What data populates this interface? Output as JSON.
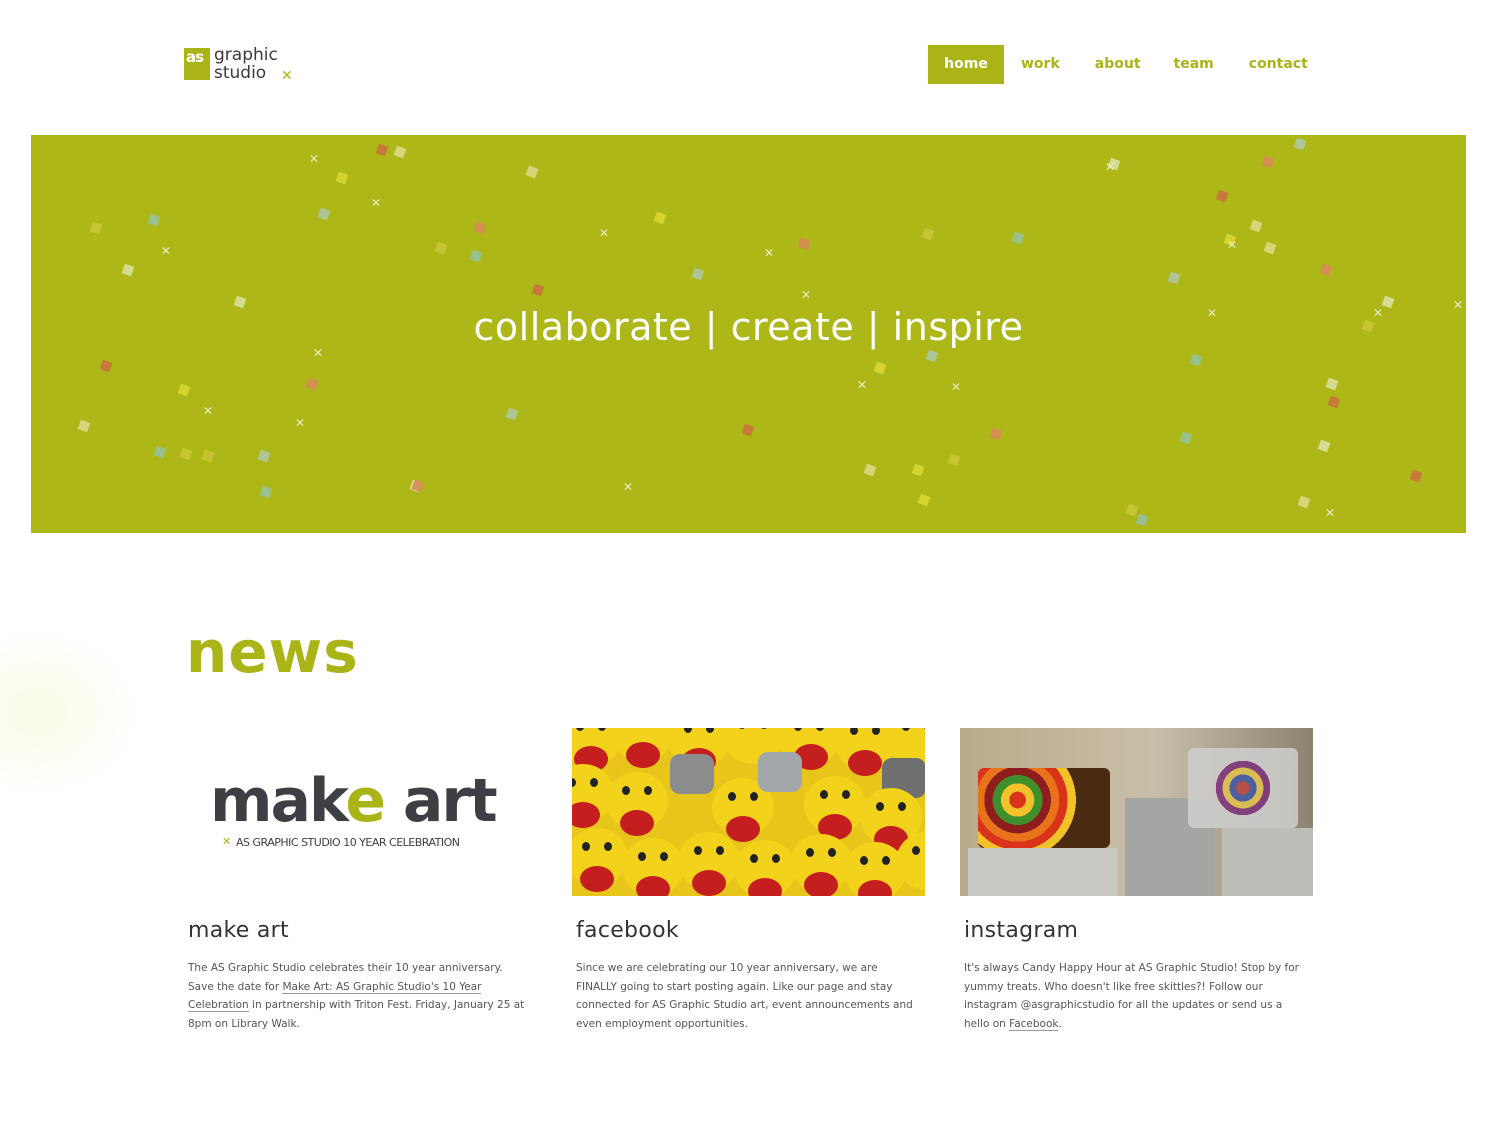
{
  "header": {
    "logo": {
      "mark": "as",
      "line1": "graphic",
      "line2": "studio"
    },
    "nav": [
      {
        "label": "home",
        "active": true
      },
      {
        "label": "work"
      },
      {
        "label": "about"
      },
      {
        "label": "team"
      },
      {
        "label": "contact"
      }
    ]
  },
  "hero": {
    "tagline": "collaborate | create | inspire",
    "color": "#adb717"
  },
  "news": {
    "title": "news",
    "accent_color": "#aab416",
    "cards": [
      {
        "image_title": "make art",
        "image_subtitle": "AS GRAPHIC STUDIO 10 YEAR CELEBRATION",
        "title": "make art",
        "text_before": "The AS Graphic Studio celebrates their 10 year anniversary. Save the date for ",
        "link": "Make Art: AS Graphic Studio's 10 Year Celebration",
        "text_after": " in partnership with Triton Fest. Friday, January 25 at 8pm on Library Walk."
      },
      {
        "title": "facebook",
        "text": "Since we are celebrating our 10 year anniversary, we are FINALLY going to start posting again. Like our page and stay connected for AS Graphic Studio art, event announcements and even employment opportunities."
      },
      {
        "title": "instagram",
        "text_before": "It's always Candy Happy Hour at AS Graphic Studio! Stop by for yummy treats. Who doesn't like free skittles?! Follow our instagram @asgraphicstudio for all the updates or send us a hello on ",
        "link": "Facebook",
        "text_after": "."
      }
    ]
  }
}
